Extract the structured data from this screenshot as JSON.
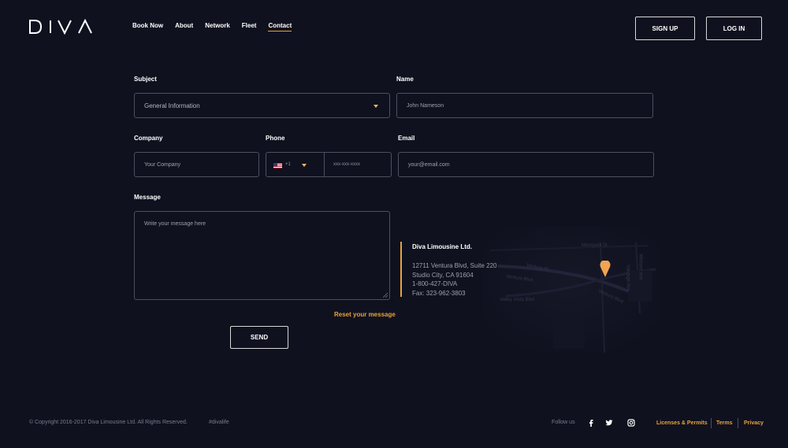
{
  "brand": {
    "logo_text": "DIVA"
  },
  "nav": {
    "items": [
      {
        "label": "Book Now"
      },
      {
        "label": "About"
      },
      {
        "label": "Network"
      },
      {
        "label": "Fleet"
      },
      {
        "label": "Contact",
        "active": true
      }
    ]
  },
  "auth": {
    "signup_label": "SIGN UP",
    "login_label": "LOG IN"
  },
  "form": {
    "subject": {
      "label": "Subject",
      "value": "General Information"
    },
    "name": {
      "label": "Name",
      "placeholder": "John Nameson"
    },
    "company": {
      "label": "Company",
      "placeholder": "Your Company"
    },
    "phone": {
      "label": "Phone",
      "country_code": "+1",
      "placeholder": "xxx-xxx-xxxx"
    },
    "email": {
      "label": "Email",
      "placeholder": "your@email.com"
    },
    "message": {
      "label": "Message",
      "placeholder": "Write your message here"
    },
    "reset_label": "Reset your message",
    "send_label": "SEND"
  },
  "contact_info": {
    "company": "Diva Limousine Ltd.",
    "address_line1": "12711 Ventura Blvd, Suite 220",
    "address_line2": "Studio City, CA 91604",
    "phone": "1-800-427-DIVA",
    "fax": "Fax: 323-962-3803"
  },
  "map": {
    "labels": [
      "Moorpark St",
      "Ventura Pl",
      "Ventura Blvd",
      "Valley Vista Blvd",
      "Ventura Blvd",
      "Whitsett Ave",
      "Vantage Ave"
    ]
  },
  "footer": {
    "copyright": "© Copyright 2016-2017 Diva Limousine Ltd. All Rights Reserved.",
    "hashtag": "#divalife",
    "follow_label": "Follow us",
    "social": [
      "facebook-icon",
      "twitter-icon",
      "instagram-icon"
    ],
    "links": [
      {
        "label": "Licenses & Permits"
      },
      {
        "label": "Terms"
      },
      {
        "label": "Privacy"
      }
    ]
  },
  "colors": {
    "background": "#10111f",
    "accent": "#e5a33c",
    "border": "#4d4f60",
    "muted_text": "#9ea0ad"
  }
}
